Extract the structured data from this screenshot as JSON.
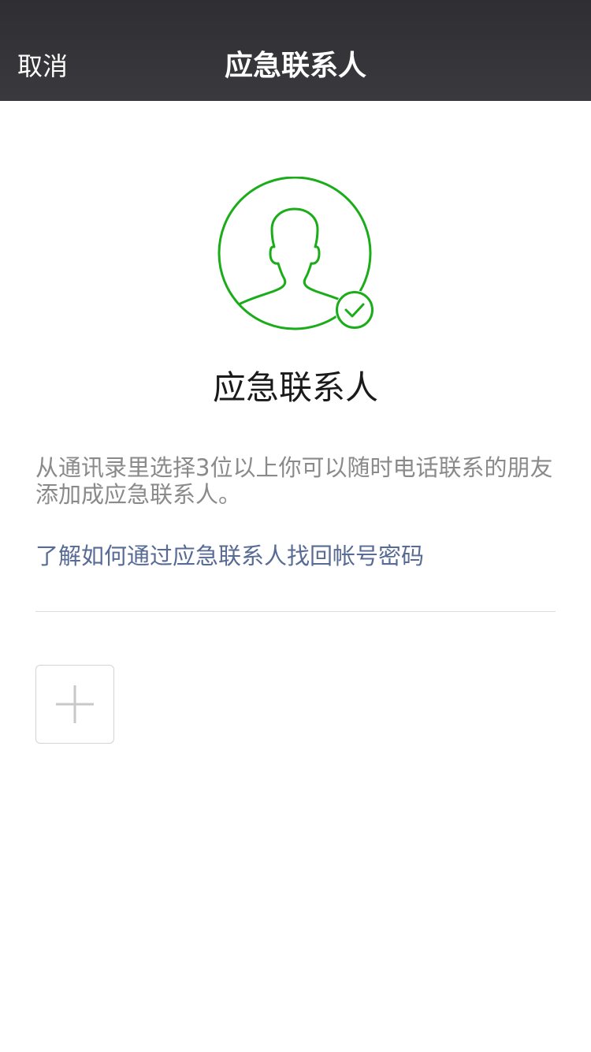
{
  "navbar": {
    "cancel_label": "取消",
    "title": "应急联系人"
  },
  "main": {
    "avatar_icon": "user-check-icon",
    "title": "应急联系人",
    "description": "从通讯录里选择3位以上你可以随时电话联系的朋友添加成应急联系人。",
    "help_link": "了解如何通过应急联系人找回帐号密码",
    "add_icon": "plus-icon"
  },
  "colors": {
    "navbar_bg": "#333337",
    "accent_green": "#1aad19",
    "link_blue": "#576b95",
    "description_gray": "#8a8a8a",
    "divider": "#dcdcdc"
  }
}
